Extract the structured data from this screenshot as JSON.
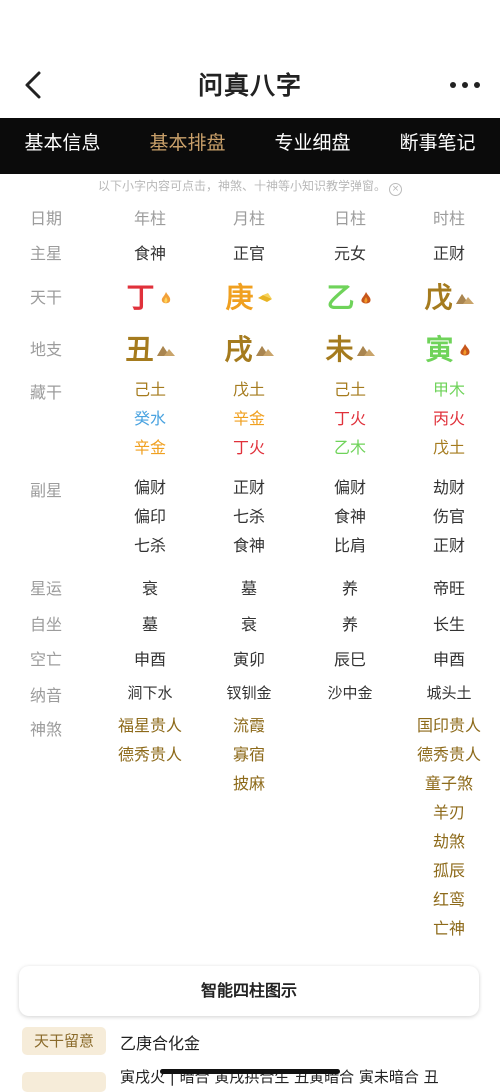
{
  "header": {
    "title": "问真八字"
  },
  "tabs": [
    "基本信息",
    "基本排盘",
    "专业细盘",
    "断事笔记"
  ],
  "hint": "以下小字内容可点击，神煞、十神等小知识教学弹窗。",
  "rows": {
    "date": {
      "label": "日期",
      "cols": [
        "年柱",
        "月柱",
        "日柱",
        "时柱"
      ]
    },
    "main_star": {
      "label": "主星",
      "cols": [
        "食神",
        "正官",
        "元女",
        "正财"
      ]
    },
    "tiangan": {
      "label": "天干",
      "cols": [
        "丁",
        "庚",
        "乙",
        "戊"
      ],
      "colors": [
        "#e0313b",
        "#f0a020",
        "#6fd35a",
        "#a57b1e"
      ]
    },
    "dizhi": {
      "label": "地支",
      "cols": [
        "丑",
        "戌",
        "未",
        "寅"
      ],
      "colors": [
        "#a57b1e",
        "#a57b1e",
        "#a57b1e",
        "#6fd35a"
      ]
    },
    "canggan": {
      "label": "藏干",
      "cols": [
        [
          "己土",
          "癸水",
          "辛金"
        ],
        [
          "戊土",
          "辛金",
          "丁火"
        ],
        [
          "己土",
          "丁火",
          "乙木"
        ],
        [
          "甲木",
          "丙火",
          "戊土"
        ]
      ]
    },
    "fuxing": {
      "label": "副星",
      "cols": [
        [
          "偏财",
          "偏印",
          "七杀"
        ],
        [
          "正财",
          "七杀",
          "食神"
        ],
        [
          "偏财",
          "食神",
          "比肩"
        ],
        [
          "劫财",
          "伤官",
          "正财"
        ]
      ]
    },
    "xingyun": {
      "label": "星运",
      "cols": [
        "衰",
        "墓",
        "养",
        "帝旺"
      ]
    },
    "zizuo": {
      "label": "自坐",
      "cols": [
        "墓",
        "衰",
        "养",
        "长生"
      ]
    },
    "kongwang": {
      "label": "空亡",
      "cols": [
        "申酉",
        "寅卯",
        "辰巳",
        "申酉"
      ]
    },
    "nayin": {
      "label": "纳音",
      "cols": [
        "涧下水",
        "钗钏金",
        "沙中金",
        "城头土"
      ]
    },
    "shensha": {
      "label": "神煞",
      "cols": [
        [
          "福星贵人",
          "德秀贵人"
        ],
        [
          "流霞",
          "寡宿",
          "披麻"
        ],
        [],
        [
          "国印贵人",
          "德秀贵人",
          "童子煞",
          "羊刃",
          "劫煞",
          "孤辰",
          "红鸾",
          "亡神"
        ]
      ]
    }
  },
  "bottom": {
    "button": "智能四柱图示",
    "tag1": "天干留意",
    "tag1_text": "乙庚合化金",
    "tag2_text": "寅戌火 | 暗合 寅戌拱合生 丑寅暗合 寅未暗合 丑"
  },
  "colors": {
    "accent": "#c9a06a",
    "tabbar": "#0b0b0b",
    "fire": "#e0313b",
    "metal": "#f0a020",
    "wood": "#6fd35a",
    "earth": "#a57b1e",
    "water": "#4aa3e0"
  }
}
